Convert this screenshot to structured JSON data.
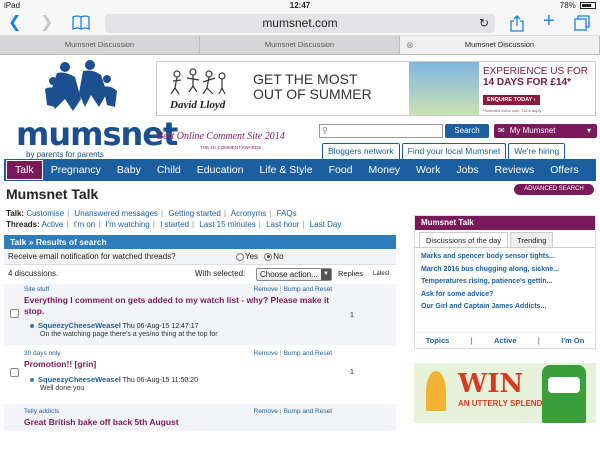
{
  "status_bar": {
    "carrier": "iPad",
    "time": "12:47",
    "battery": "78%",
    "battery_level": 0.78
  },
  "browser": {
    "url": "mumsnet.com",
    "tabs": [
      {
        "label": "Mumsnet Discussion",
        "active": false
      },
      {
        "label": "Mumsnet Discussion",
        "active": false
      },
      {
        "label": "Mumsnet Discussion",
        "active": true
      }
    ]
  },
  "header": {
    "logo_text": "mumsnet",
    "tagline": "by parents for parents",
    "award": "Best Online Comment Site 2014",
    "award_sub": "THE 4G COMMENT AWARDS",
    "ad": {
      "brand": "David Lloyd",
      "headline_1": "GET THE MOST",
      "headline_2": "OUT OF SUMMER",
      "offer_1": "EXPERIENCE US FOR",
      "offer_2": "14 DAYS FOR £14*",
      "button": "ENQUIRE TODAY ›",
      "fine_print": "*Selected clubs only. T&Cs apply."
    },
    "search_button": "Search",
    "my_mumsnet": "My Mumsnet",
    "links": [
      "Bloggers network",
      "Find your local Mumsnet",
      "We're hiring"
    ]
  },
  "nav": [
    "Talk",
    "Pregnancy",
    "Baby",
    "Child",
    "Education",
    "Life & Style",
    "Food",
    "Money",
    "Work",
    "Jobs",
    "Reviews",
    "Offers"
  ],
  "talk": {
    "title": "Mumsnet Talk",
    "advanced_search": "ADVANCED SEARCH",
    "row1_label": "Talk:",
    "row1_links": [
      "Customise",
      "Unanswered messages",
      "Getting started",
      "Acronyms",
      "FAQs"
    ],
    "row2_label": "Threads:",
    "row2_links": [
      "Active",
      "I'm on",
      "I'm watching",
      "I started",
      "Last 15 minutes",
      "Last hour",
      "Last Day"
    ]
  },
  "results": {
    "header": "Talk » Results of search",
    "notify_label": "Receive email notification for watched threads?",
    "notify_yes": "Yes",
    "notify_no": "No",
    "count": "4 discussions.",
    "with_selected": "With selected:",
    "action_placeholder": "Choose action...",
    "col_replies": "Replies",
    "col_latest": "Latest",
    "remove_label": "Remove",
    "bump_label": "Bump and Reset",
    "threads": [
      {
        "category": "Site stuff",
        "title": "Everything I comment on gets added to my watch list - why? Please make it stop.",
        "replies": "1",
        "author": "SqueezyCheeseWeasel",
        "date": "Thu 06-Aug-15 12:47:17",
        "message": "On the watching page there's a yes/no thing at the top for"
      },
      {
        "category": "30 days only",
        "title": "Promotion!! [grin]",
        "replies": "1",
        "author": "SqueezyCheeseWeasel",
        "date": "Thu 06-Aug-15 11:50:20",
        "message": "Well done you"
      },
      {
        "category": "Telly addicts",
        "title": "Great British bake off back 5th August"
      }
    ]
  },
  "sidebar": {
    "header": "Mumsnet Talk",
    "tabs": [
      "Discussions of the day",
      "Trending"
    ],
    "items": [
      "Marks and spencer body sensor tights...",
      "March 2016 bus chugging along, sickne...",
      "Temperatures rising, patience's gettin...",
      "Ask for some advice?",
      "Our Girl and Captain James Addicts..."
    ],
    "footer": [
      "Topics",
      "Active",
      "I'm On"
    ]
  },
  "promo": {
    "line1": "WIN",
    "line2": "AN UTTERLY SPLENDIFEROUS"
  }
}
